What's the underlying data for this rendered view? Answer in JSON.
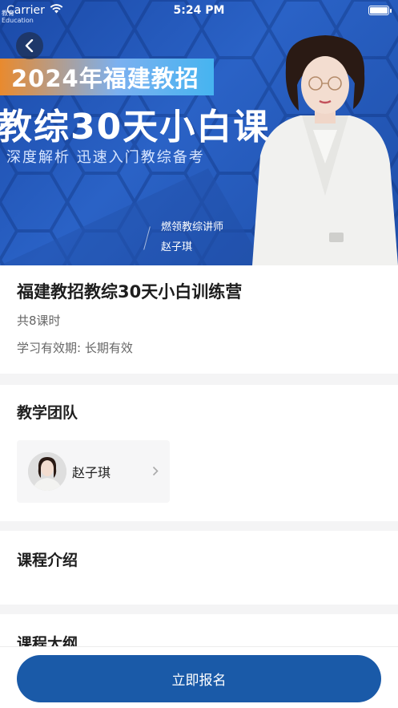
{
  "status_bar": {
    "carrier": "Carrier",
    "time": "5:24 PM"
  },
  "banner": {
    "brand": "教育\nEducation",
    "tag_title": "2024年福建教招",
    "big_title": "教综30天小白课",
    "subtitle": "深度解析 迅速入门教综备考",
    "teacher_role": "燃领教综讲师",
    "teacher_name": "赵子琪"
  },
  "course": {
    "title": "福建教招教综30天小白训练营",
    "lessons": "共8课时",
    "validity": "学习有效期: 长期有效"
  },
  "team": {
    "title": "教学团队",
    "teachers": [
      {
        "name": "赵子琪"
      }
    ]
  },
  "intro": {
    "title": "课程介绍"
  },
  "outline": {
    "title": "课程大纲"
  },
  "footer": {
    "enroll_label": "立即报名"
  },
  "colors": {
    "primary": "#1a5aa8",
    "banner_blue": "#2a62c6",
    "page_bg": "#f4f4f5"
  },
  "icons": [
    "back-arrow-icon",
    "wifi-icon",
    "battery-icon",
    "chevron-right-icon"
  ]
}
